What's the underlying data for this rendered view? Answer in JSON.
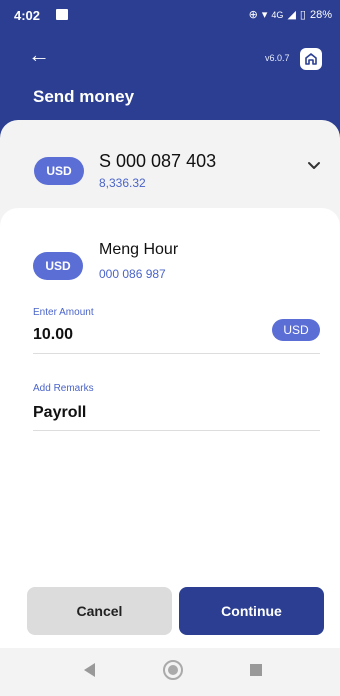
{
  "status_bar": {
    "time": "4:02",
    "network": "4G",
    "battery": "28%"
  },
  "header": {
    "version": "v6.0.7",
    "title": "Send money"
  },
  "from_account": {
    "currency": "USD",
    "number": "S 000 087 403",
    "balance": "8,336.32"
  },
  "to_account": {
    "currency": "USD",
    "name": "Meng Hour",
    "number": "000 086 987"
  },
  "amount": {
    "label": "Enter Amount",
    "value": "10.00",
    "currency": "USD"
  },
  "remarks": {
    "label": "Add Remarks",
    "value": "Payroll"
  },
  "buttons": {
    "cancel": "Cancel",
    "continue": "Continue"
  },
  "colors": {
    "primary": "#2b3e92",
    "badge": "#5b6ed6",
    "link": "#4b64c8"
  }
}
